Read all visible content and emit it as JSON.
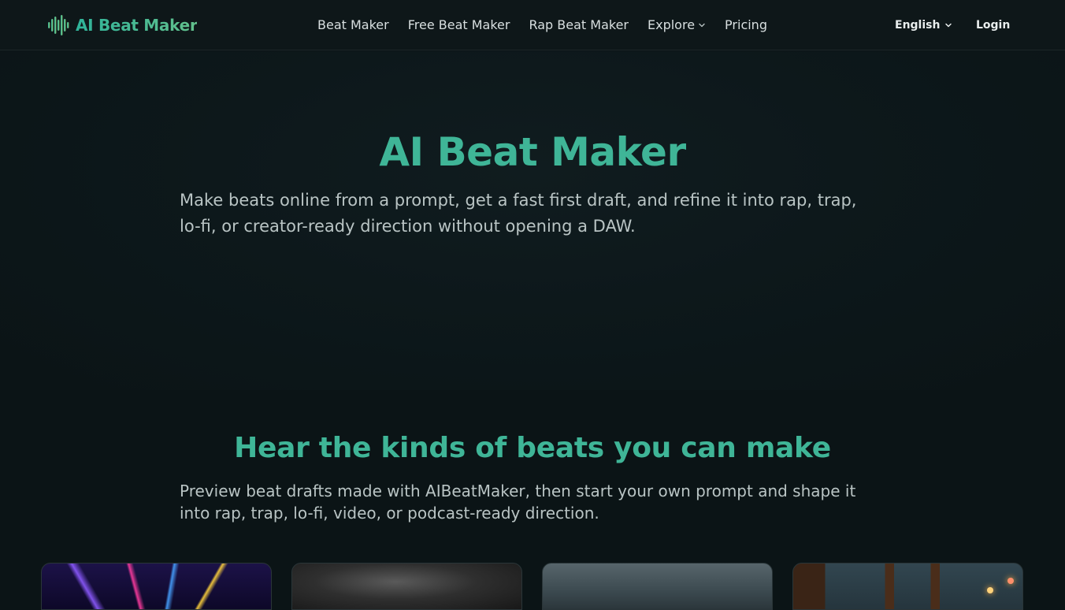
{
  "brand": {
    "name": "AI Beat Maker",
    "icon": "waveform-icon",
    "gradient_start": "#2fb39a",
    "gradient_end": "#62c08c"
  },
  "nav": {
    "links": [
      {
        "label": "Beat Maker"
      },
      {
        "label": "Free Beat Maker"
      },
      {
        "label": "Rap Beat Maker"
      },
      {
        "label": "Explore",
        "icon": "chevron-down-icon"
      },
      {
        "label": "Pricing"
      }
    ],
    "language": {
      "label": "English",
      "icon": "chevron-down-icon"
    },
    "login_label": "Login"
  },
  "hero": {
    "title": "AI Beat Maker",
    "subtitle": "Make beats online from a prompt, get a fast first draft, and refine it into rap, trap, lo-fi, or creator-ready direction without opening a DAW."
  },
  "showcase": {
    "title": "Hear the kinds of beats you can make",
    "subtitle": "Preview beat drafts made with AIBeatMaker, then start your own prompt and shape it into rap, trap, lo-fi, video, or podcast-ready direction.",
    "cards": [
      {
        "image": "neon-laser-concert-image"
      },
      {
        "image": "dark-storm-clouds-image"
      },
      {
        "image": "overcast-landscape-image"
      },
      {
        "image": "rainy-city-window-image"
      }
    ]
  },
  "colors": {
    "accent": "#3fb597",
    "background": "#0b1416",
    "nav_background": "#0e1719"
  }
}
